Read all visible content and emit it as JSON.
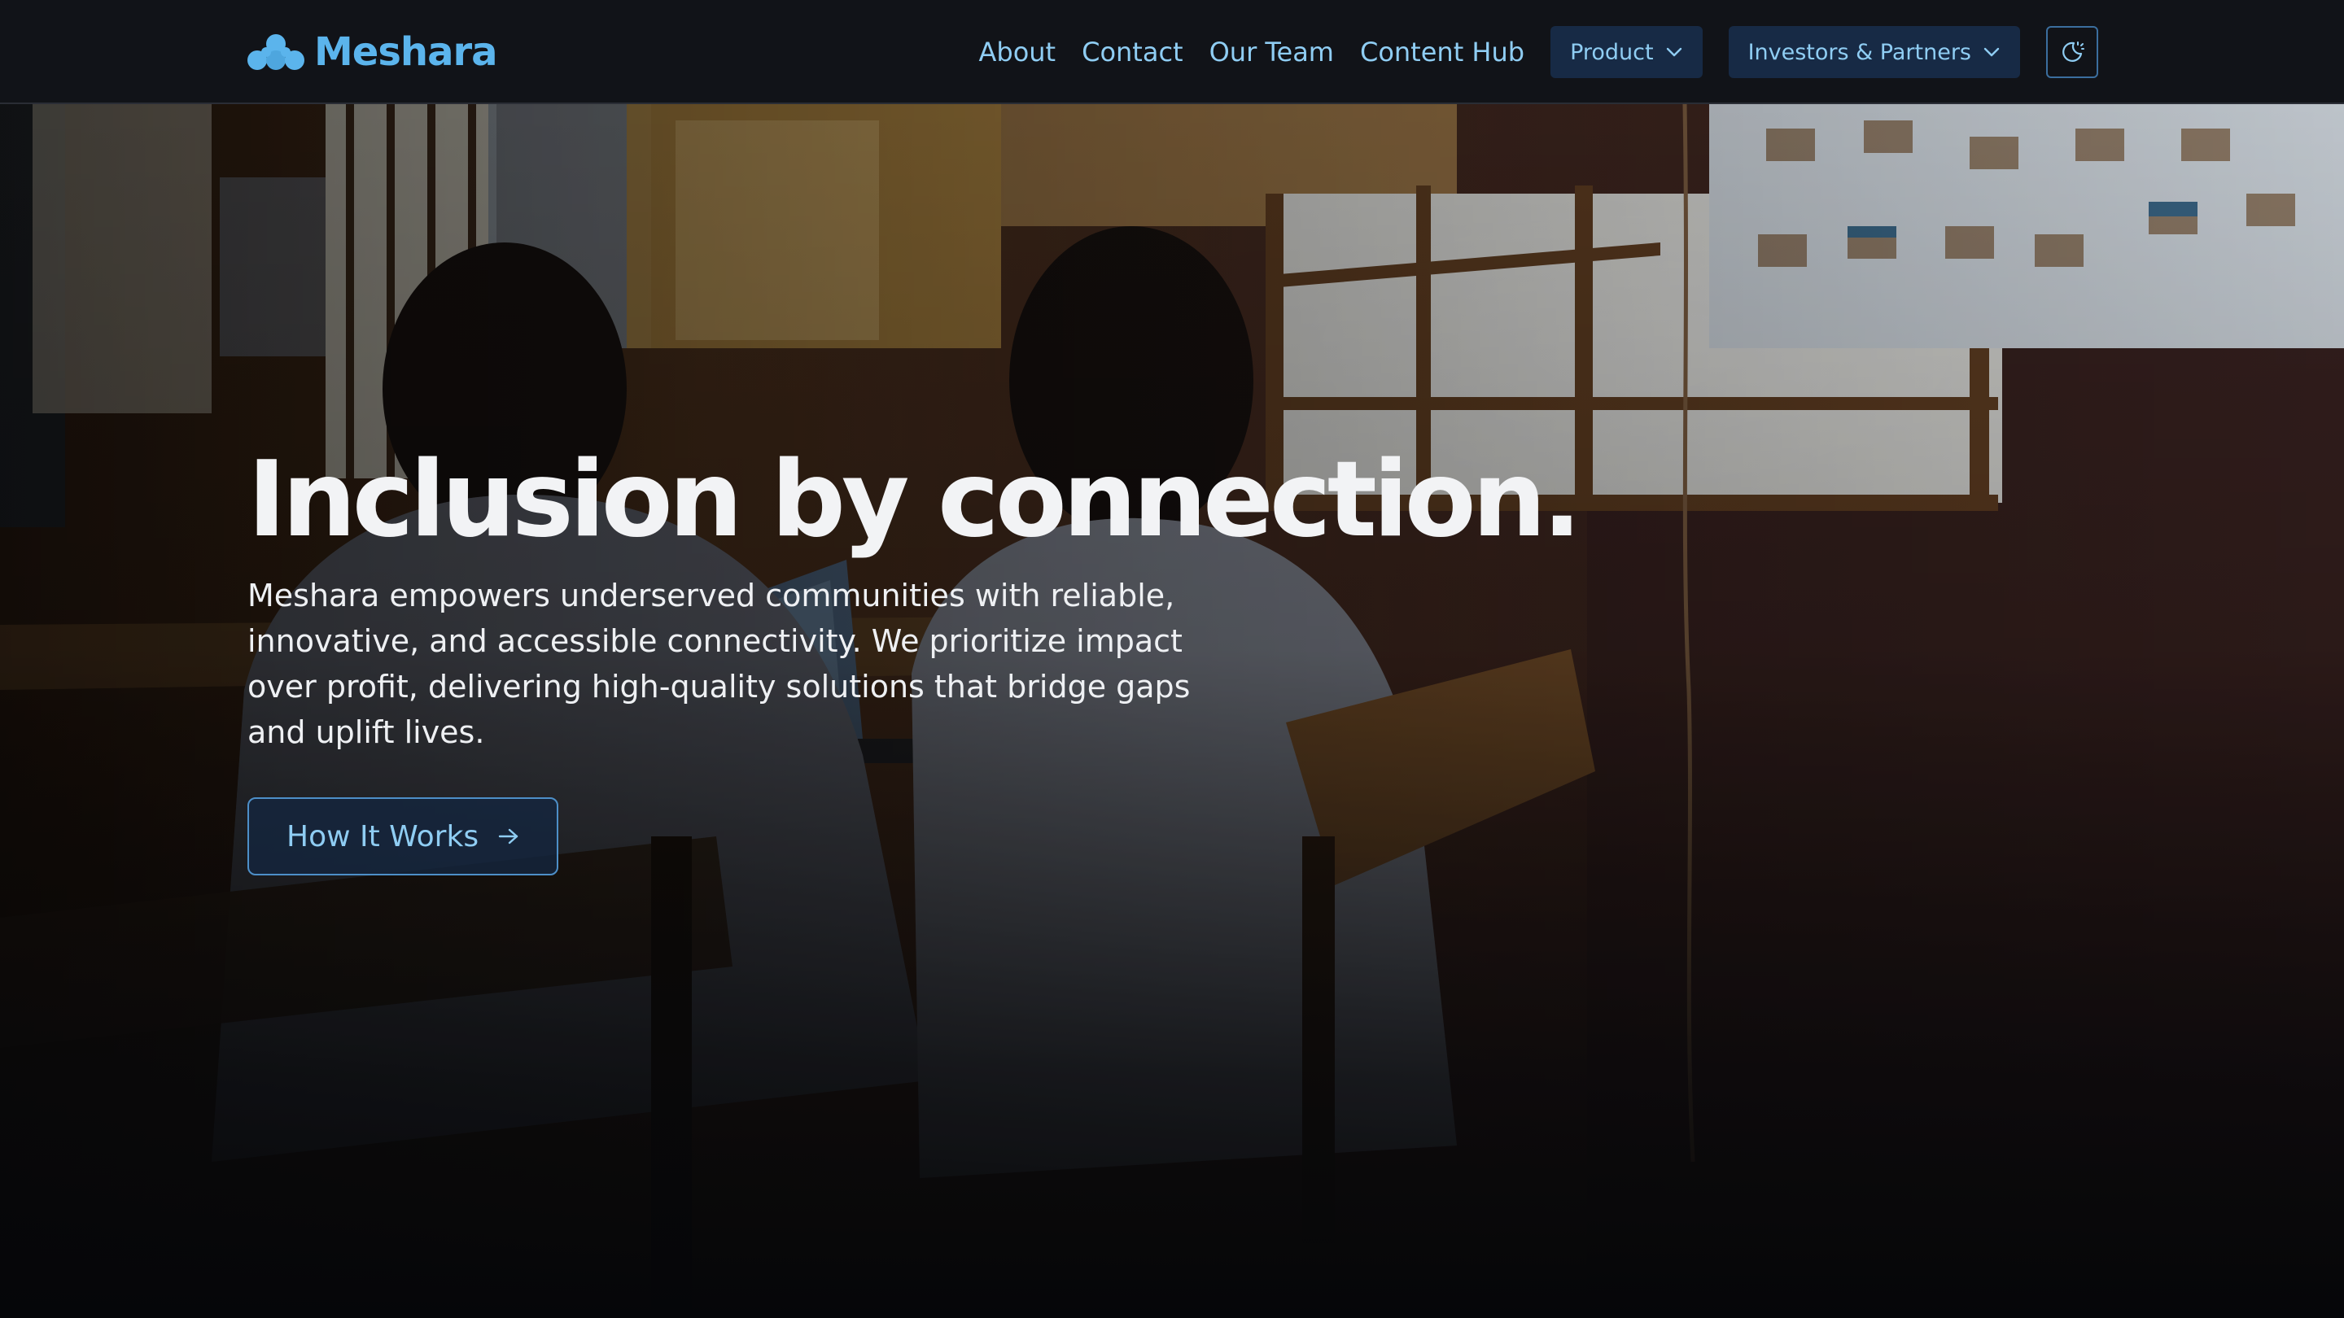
{
  "brand": {
    "name": "Meshara",
    "logo_icon": "three-circles-logo",
    "color": "#5bb4ec"
  },
  "nav": {
    "links": [
      "About",
      "Contact",
      "Our Team",
      "Content Hub"
    ],
    "product_label": "Product",
    "investors_label": "Investors & Partners",
    "theme_toggle_icon": "moon-sun-icon"
  },
  "hero": {
    "title": "Inclusion by connection.",
    "description": "Meshara empowers underserved communities with reliable, innovative, and accessible connectivity. We prioritize impact over profit, delivering high-quality solutions that bridge gaps and uplift lives.",
    "cta_label": "How It Works",
    "cta_icon": "arrow-right-icon",
    "background": "photo-two-students-using-laptops-in-classroom"
  },
  "colors": {
    "nav_bg": "#111318",
    "accent": "#8fcdf3",
    "dropdown_bg": "#172a45",
    "title": "#f2f3f5"
  }
}
